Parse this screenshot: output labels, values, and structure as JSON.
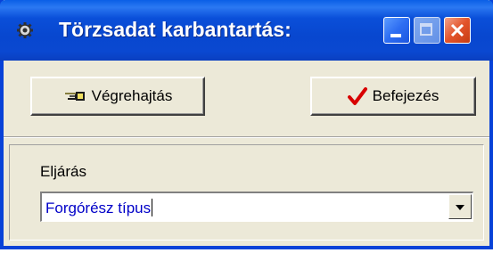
{
  "window": {
    "title": "Törzsadat karbantartás:",
    "icon": "gear-icon",
    "controls": {
      "minimize": "minimize-icon",
      "maximize": "maximize-icon",
      "close": "close-icon"
    }
  },
  "toolbar": {
    "execute_label": "Végrehajtás",
    "execute_icon": "pointing-hand-icon",
    "finish_label": "Befejezés",
    "finish_icon": "checkmark-icon"
  },
  "form": {
    "procedure_label": "Eljárás",
    "procedure_value": "Forgórész típus"
  },
  "colors": {
    "titlebar": "#0a4fd9",
    "window_bg": "#ece9d8",
    "combo_text": "#0000c8",
    "checkmark": "#d80000"
  }
}
